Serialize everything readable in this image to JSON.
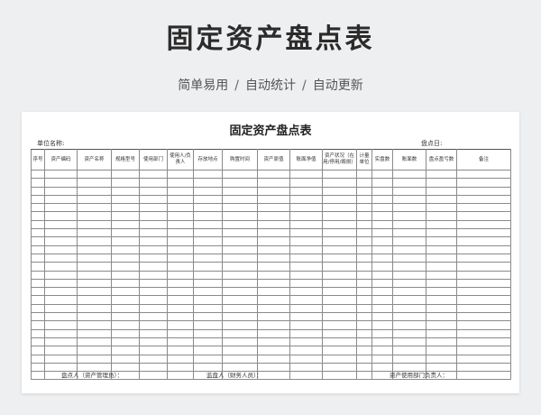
{
  "header": {
    "title": "固定资产盘点表",
    "subtitle_items": [
      "简单易用",
      "自动统计",
      "自动更新"
    ],
    "separator": "/"
  },
  "sheet": {
    "title": "固定资产盘点表",
    "unit_label": "单位名称:",
    "date_label": "盘点日:",
    "columns": [
      "序号",
      "资产编码",
      "资产名称",
      "规格型号",
      "使用部门",
      "使用人/负责人",
      "存放地点",
      "购置时间",
      "资产原值",
      "账面净值",
      "资产状况（在用/停用/毁损）",
      "计量单位",
      "实盘数",
      "账面数",
      "盘点盈亏数",
      "备注"
    ],
    "row_count": 25,
    "footer": {
      "counter": "盘点人（资产管理员）：",
      "supervisor": "监盘人（财务人员）：",
      "dept_head": "资产使用部门负责人："
    }
  }
}
